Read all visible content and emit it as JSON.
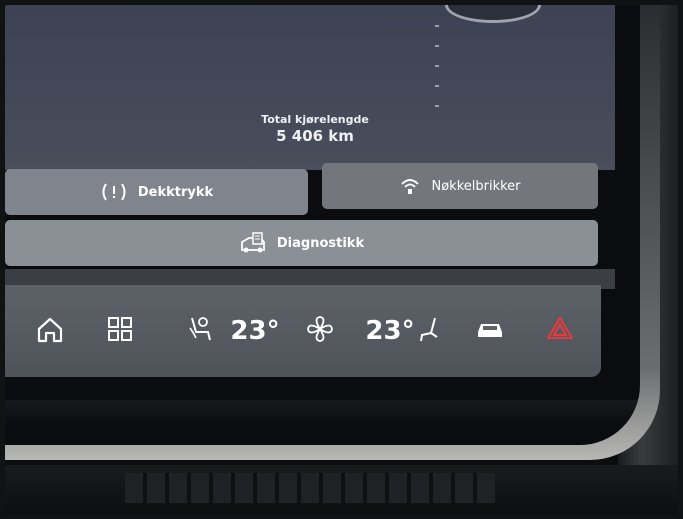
{
  "odometer": {
    "label": "Total kjørelengde",
    "value": "5 406 km"
  },
  "buttons": {
    "tire_pressure": "Dekktrykk",
    "key_tags": "Nøkkelbrikker",
    "diagnostics": "Diagnostikk"
  },
  "climate": {
    "left_temp": "23°",
    "right_temp": "23°"
  },
  "icons": [
    "home-icon",
    "apps-grid-icon",
    "seat-heat-icon",
    "fan-icon",
    "car-icon",
    "hazard-icon",
    "tire-warning-icon",
    "wifi-key-icon",
    "diagnostics-icon"
  ],
  "colors": {
    "hazard": "#e8393d"
  }
}
